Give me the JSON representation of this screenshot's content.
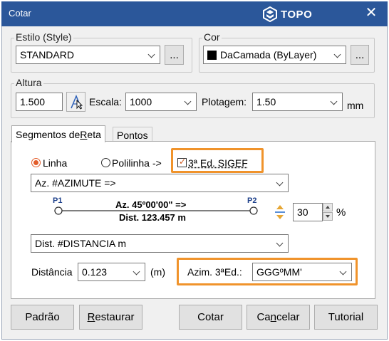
{
  "window": {
    "title": "Cotar",
    "brand": "TOPO",
    "close_glyph": "✕"
  },
  "style_group": {
    "legend": "Estilo (Style)",
    "value": "STANDARD",
    "browse_label": "..."
  },
  "color_group": {
    "legend": "Cor",
    "value": "DaCamada (ByLayer)",
    "swatch_color": "#000000",
    "browse_label": "..."
  },
  "height_group": {
    "legend": "Altura",
    "height_value": "1.500",
    "scale_label": "Escala:",
    "scale_value": "1000",
    "plot_label": "Plotagem:",
    "plot_value": "1.50",
    "unit": "mm"
  },
  "tabs": [
    {
      "label_pre": "Segmentos de ",
      "label_u": "R",
      "label_post": "eta",
      "active": true
    },
    {
      "label": "Pontos",
      "active": false
    }
  ],
  "segment_tab": {
    "radio_line": "Linha",
    "radio_polyline": "Polilinha",
    "arrow_text": "->",
    "checkbox_label": "3ª Ed. SIGEF",
    "checkbox_checked": true,
    "azimuth_combo": "Az.  #AZIMUTE =>",
    "preview": {
      "p1": "P1",
      "p2": "P2",
      "az_text": "Az.  45º00'00\" =>",
      "dist_text": "Dist.  123.457 m"
    },
    "percent_value": "30",
    "percent_unit": "%",
    "distance_combo": "Dist. #DISTANCIA m",
    "distance_label": "Distância",
    "distance_value": "0.123",
    "distance_unit": "(m)",
    "azim_label": "Azim. 3ªEd.:",
    "azim_value": "GGGºMM'"
  },
  "footer": {
    "default_label": "Padrão",
    "restore_label_u": "R",
    "restore_label_rest": "estaurar",
    "ok_label": "Cotar",
    "cancel_pre": "Ca",
    "cancel_u": "n",
    "cancel_post": "celar",
    "tutorial_label": "Tutorial"
  },
  "colors": {
    "titlebar": "#2b579a",
    "highlight": "#f0932b",
    "radio_accent": "#e35d2a"
  }
}
